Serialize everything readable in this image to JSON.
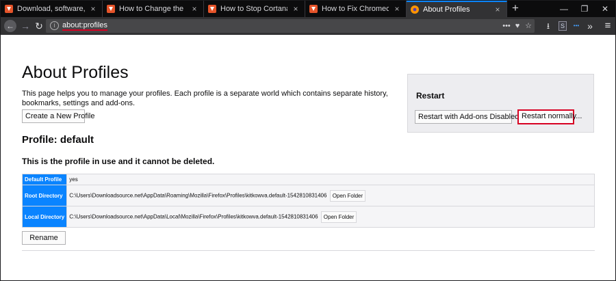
{
  "tabs": [
    {
      "title": "Download, software, drivers, g",
      "active": false
    },
    {
      "title": "How to Change the Email Add",
      "active": false
    },
    {
      "title": "How to Stop Cortana Accessin",
      "active": false
    },
    {
      "title": "How to Fix Chromecast No Au",
      "active": false
    },
    {
      "title": "About Profiles",
      "active": true
    }
  ],
  "tab_close_glyph": "×",
  "new_tab_glyph": "+",
  "window_controls": {
    "minimize": "—",
    "restore": "❐",
    "close": "✕"
  },
  "nav": {
    "back": "←",
    "forward": "→",
    "reload": "↻",
    "info": "i"
  },
  "urlbar": {
    "url": "about:profiles",
    "more": "•••",
    "pocket": "♥",
    "bookmark": "☆"
  },
  "toolbar": {
    "downloads": "⭳",
    "sidebar_ext": "S",
    "ext_dots": "•••",
    "overflow": "»",
    "menu": "≡"
  },
  "page": {
    "title": "About Profiles",
    "intro": "This page helps you to manage your profiles. Each profile is a separate world which contains separate history, bookmarks, settings and add-ons.",
    "create_button": "Create a New Profile",
    "restart": {
      "heading": "Restart",
      "disabled_button": "Restart with Add-ons Disabled...",
      "normal_button": "Restart normally..."
    },
    "profile_heading": "Profile: default",
    "in_use_text": "This is the profile in use and it cannot be deleted.",
    "table": {
      "default_label": "Default Profile",
      "default_value": "yes",
      "root_label": "Root Directory",
      "root_value": "C:\\Users\\Downloadsource.net\\AppData\\Roaming\\Mozilla\\Firefox\\Profiles\\kitkowva.default-1542810831406",
      "local_label": "Local Directory",
      "local_value": "C:\\Users\\Downloadsource.net\\AppData\\Local\\Mozilla\\Firefox\\Profiles\\kitkowva.default-1542810831406",
      "open_folder": "Open Folder"
    },
    "rename_button": "Rename"
  }
}
